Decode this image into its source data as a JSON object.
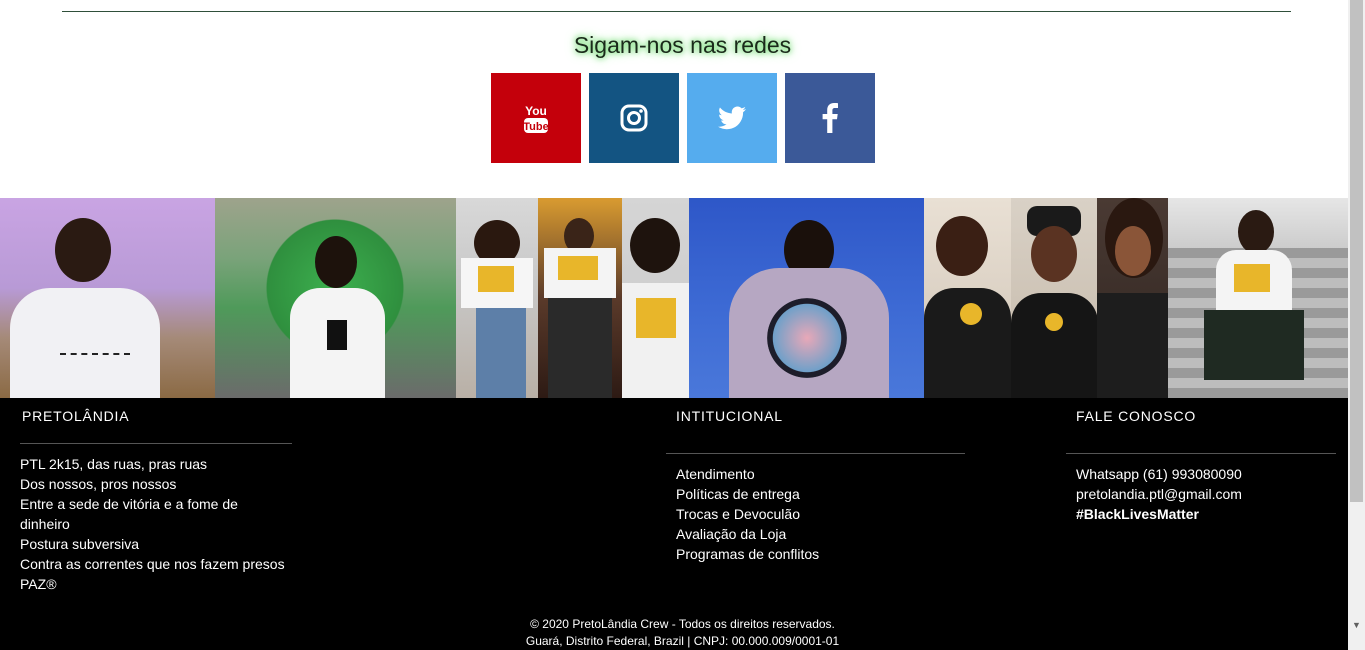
{
  "social": {
    "title": "Sigam-nos nas redes",
    "buttons": [
      {
        "name": "youtube",
        "icon": "youtube-icon",
        "label_top": "You",
        "label_bottom": "Tube",
        "color": "#c4000b"
      },
      {
        "name": "instagram",
        "icon": "instagram-icon",
        "color": "#135482"
      },
      {
        "name": "twitter",
        "icon": "twitter-icon",
        "color": "#55acee"
      },
      {
        "name": "facebook",
        "icon": "facebook-icon",
        "color": "#3b5998"
      }
    ]
  },
  "footer": {
    "col1": {
      "title": "PRETOLÂNDIA",
      "items": [
        "PTL 2k15, das ruas, pras ruas",
        "Dos nossos, pros nossos",
        "Entre a sede de vitória e a fome de",
        "dinheiro",
        "Postura subversiva",
        "Contra as correntes que nos fazem presos",
        "PAZ®"
      ]
    },
    "col2": {
      "title": "INTITUCIONAL",
      "items": [
        "Atendimento",
        "Políticas de entrega",
        "Trocas e Devoculão",
        "Avaliação da Loja",
        "Programas de conflitos"
      ]
    },
    "col3": {
      "title": "FALE CONOSCO",
      "items": [
        "Whatsapp (61) 993080090",
        "pretolandia.ptl@gmail.com",
        "#BlackLivesMatter"
      ]
    },
    "copyright_line1": "© 2020 PretoLândia Crew - Todos os direitos reservados.",
    "copyright_line2": "Guará, Distrito Federal, Brazil | CNPJ: 00.000.009/0001-01"
  }
}
